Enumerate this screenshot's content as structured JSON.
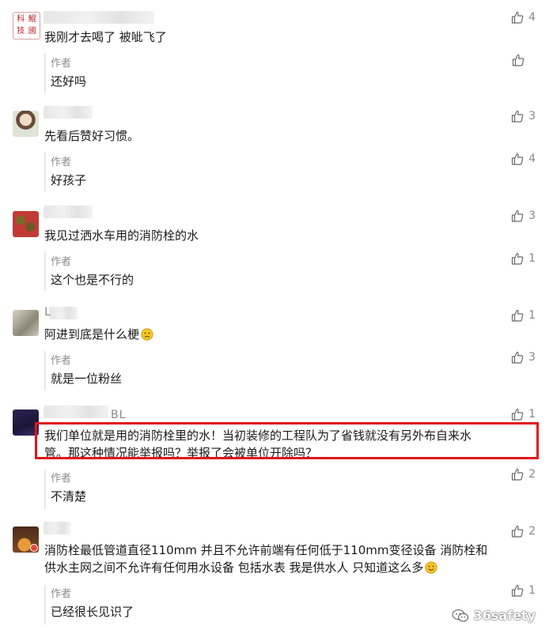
{
  "comments": [
    {
      "nick_suffix": "",
      "text": "我刚才去喝了 被呲飞了",
      "likes": "4",
      "reply": {
        "author_label": "作者",
        "text": "还好吗",
        "likes": ""
      },
      "avatar_text": [
        "科",
        "鯤",
        "技",
        "國"
      ]
    },
    {
      "nick_suffix": "",
      "text": "先看后赞好习惯。",
      "likes": "3",
      "reply": {
        "author_label": "作者",
        "text": "好孩子",
        "likes": "4"
      }
    },
    {
      "nick_suffix": "",
      "text": "我见过洒水车用的消防栓的水",
      "likes": "3",
      "reply": {
        "author_label": "作者",
        "text": "这个也是不行的",
        "likes": "1"
      }
    },
    {
      "nick_suffix": "L",
      "text": "阿进到底是什么梗",
      "likes": "1",
      "reply": {
        "author_label": "作者",
        "text": "就是一位粉丝",
        "likes": "3"
      }
    },
    {
      "nick_suffix": "BL",
      "text_line1": "我们单位就是用的消防栓里的水！当初装修的工程队为了省钱就没有另外布自来水",
      "text_line2": "管。那这种情况能举报吗？举报了会被单位开除吗？",
      "likes": "1",
      "reply": {
        "author_label": "作者",
        "text": "不清楚",
        "likes": "2"
      }
    },
    {
      "nick_suffix": "",
      "text_line1": "消防栓最低管道直径110mm 并且不允许前端有任何低于110mm变径设备 消防栓和",
      "text_line2": "供水主网之间不允许有任何用水设备 包括水表 我是供水人 只知道这么多",
      "likes": "2",
      "reply": {
        "author_label": "作者",
        "text": "已经很长见识了",
        "likes": "1"
      }
    }
  ],
  "watermark": "36safety",
  "colors": {
    "highlight": "#e3141c",
    "like_icon": "#6a6a6a",
    "muted": "#8c8c8c"
  }
}
